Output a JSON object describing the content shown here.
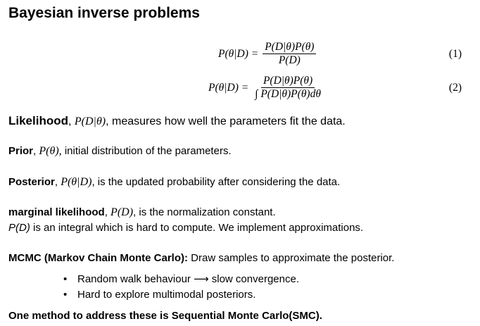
{
  "title": "Bayesian inverse problems",
  "equations": [
    {
      "lhs": "P(θ|D) =",
      "numerator": "P(D|θ)P(θ)",
      "denominator": "P(D)",
      "number": "(1)"
    },
    {
      "lhs": "P(θ|D) =",
      "numerator": "P(D|θ)P(θ)",
      "denominator": "∫ P(D|θ)P(θ)dθ",
      "number": "(2)"
    }
  ],
  "likelihood": {
    "term": "Likelihood",
    "sep": ", ",
    "math": "P(D|θ)",
    "rest": ", measures how well the parameters fit the data."
  },
  "prior": {
    "term": "Prior",
    "sep": ", ",
    "math": "P(θ),",
    "rest": " initial distribution of the parameters."
  },
  "posterior": {
    "term": "Posterior",
    "sep": ", ",
    "math": "P(θ|D)",
    "rest": ", is the updated probability after considering the data."
  },
  "marginal": {
    "term": "marginal likelihood",
    "sep": ", ",
    "math": "P(D)",
    "rest": ", is the normalization constant.",
    "line2_math": "P(D)",
    "line2_rest": " is an integral which is hard to compute. We implement approximations."
  },
  "mcmc": {
    "term": "MCMC (Markov Chain Monte Carlo):",
    "rest": " Draw samples to approximate the posterior.",
    "bullets": [
      {
        "bullet": "•",
        "text": "Random walk behaviour ⟶ slow convergence."
      },
      {
        "bullet": "•",
        "text": "Hard to explore multimodal posteriors."
      }
    ]
  },
  "conclusion": "One method to address these is Sequential Monte Carlo(SMC)."
}
